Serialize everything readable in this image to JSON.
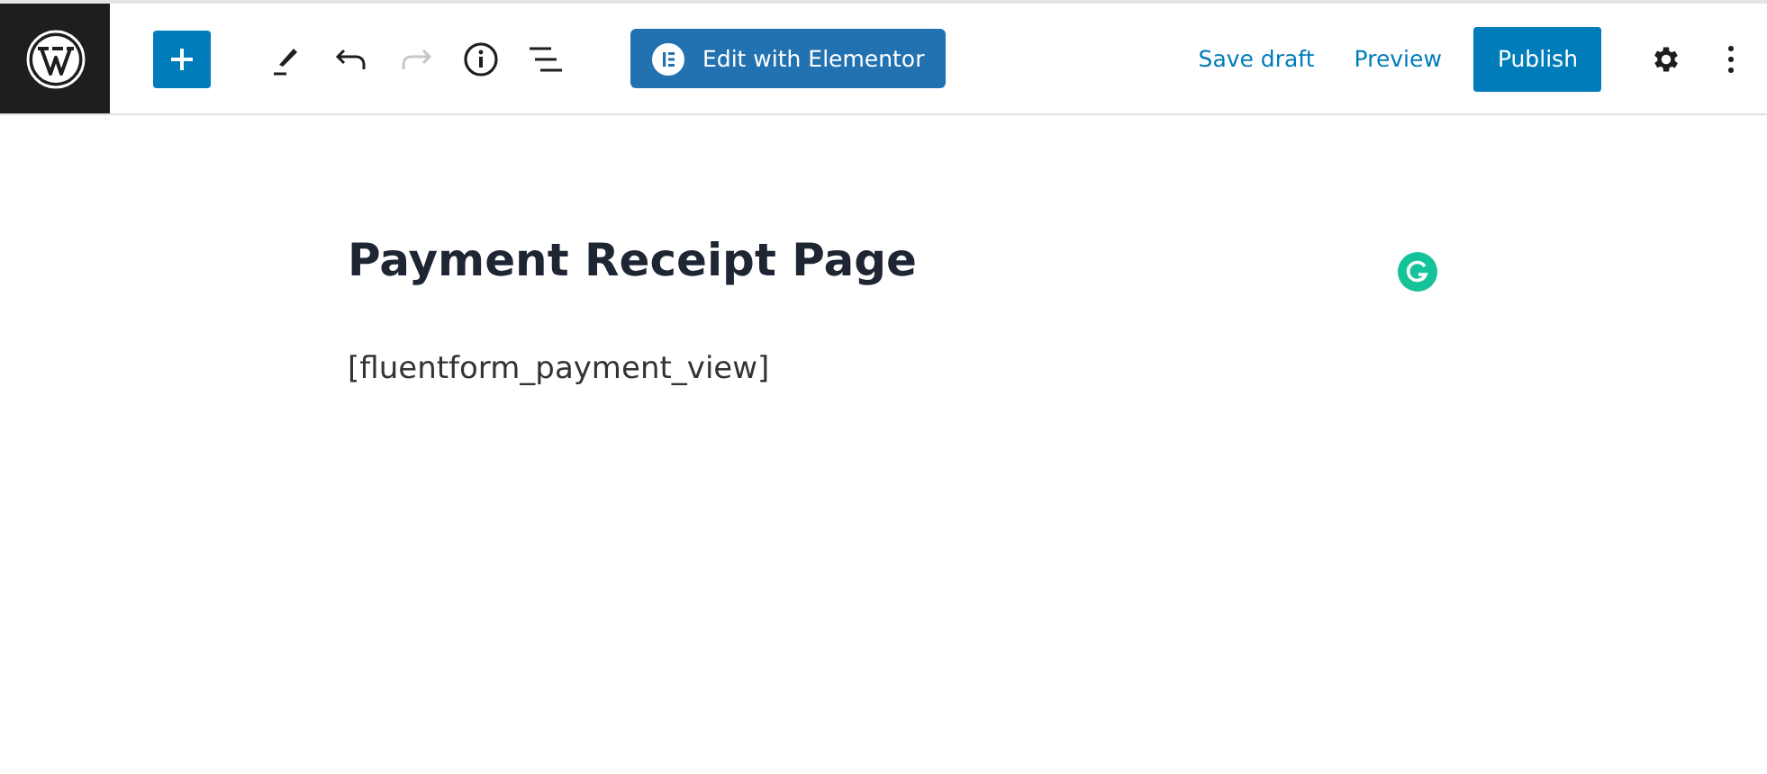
{
  "toolbar": {
    "tools": [
      {
        "kind": "add",
        "disabled": false
      },
      {
        "kind": "edit",
        "disabled": false
      },
      {
        "kind": "undo",
        "disabled": false
      },
      {
        "kind": "redo",
        "disabled": true
      },
      {
        "kind": "info",
        "disabled": false
      },
      {
        "kind": "outline",
        "disabled": false
      }
    ],
    "elementor_button": "Edit with Elementor",
    "save_draft": "Save draft",
    "preview": "Preview",
    "publish": "Publish"
  },
  "post": {
    "title": "Payment Receipt Page",
    "content": "[fluentform_payment_view]"
  }
}
